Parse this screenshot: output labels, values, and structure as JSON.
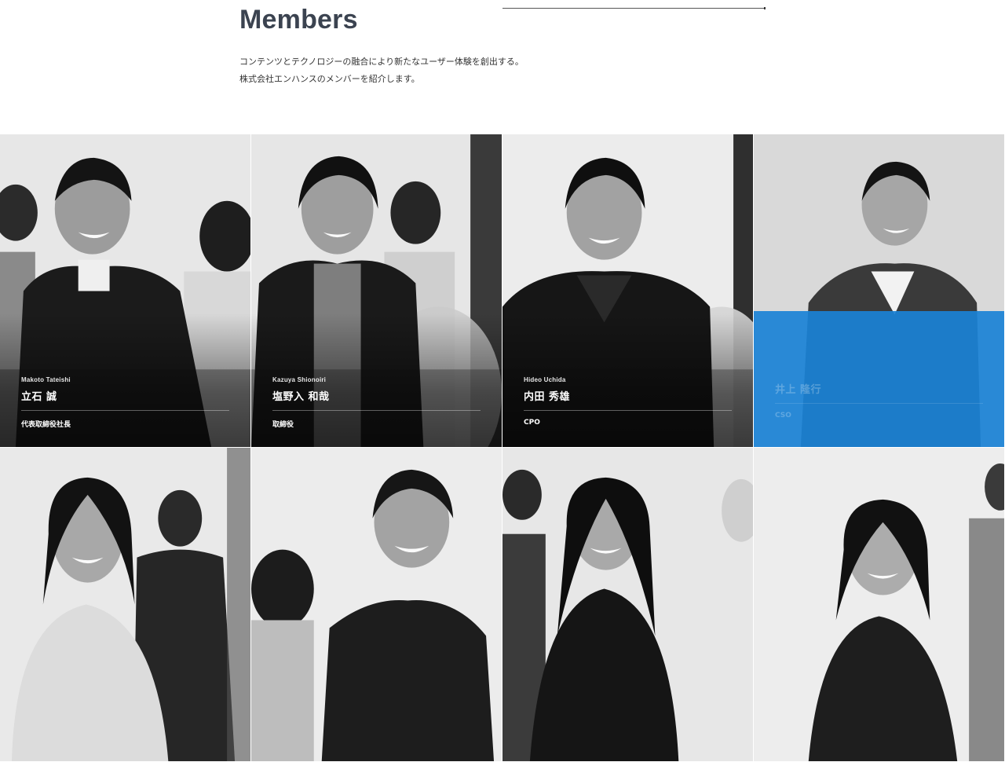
{
  "page": {
    "title": "Members",
    "intro_lines": [
      "コンテンツとテクノロジーの融合により新たなユーザー体験を創出する。",
      "株式会社エンハンスのメンバーを紹介します。"
    ]
  },
  "colors": {
    "accent": "#1a82d6",
    "heading": "#3b4350"
  },
  "members": [
    {
      "name_en": "Makoto Tateishi",
      "name_jp": "立石 誠",
      "role": "代表取締役社長"
    },
    {
      "name_en": "Kazuya Shionoiri",
      "name_jp": "塩野入 和哉",
      "role": "取締役"
    },
    {
      "name_en": "Hideo Uchida",
      "name_jp": "内田 秀雄",
      "role": "CPO"
    },
    {
      "name_en": "",
      "name_jp": "井上 隆行",
      "role": "CSO"
    }
  ]
}
